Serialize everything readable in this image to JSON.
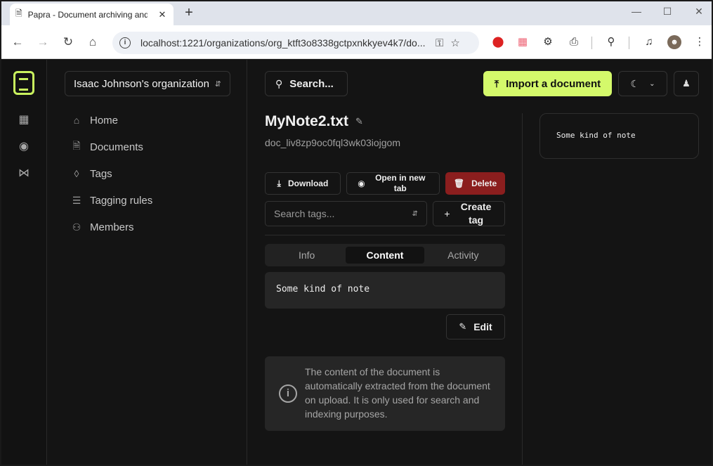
{
  "browser": {
    "tab_title": "Papra - Document archiving and",
    "url": "localhost:1221/organizations/org_ktft3o8338gctpxnkkyev4k7/do..."
  },
  "sidebar": {
    "organization": "Isaac Johnson's organization",
    "items": [
      {
        "label": "Home",
        "icon": "home-icon"
      },
      {
        "label": "Documents",
        "icon": "file-icon"
      },
      {
        "label": "Tags",
        "icon": "tag-icon"
      },
      {
        "label": "Tagging rules",
        "icon": "list-check-icon"
      },
      {
        "label": "Members",
        "icon": "users-icon"
      }
    ]
  },
  "header": {
    "search_label": "Search...",
    "import_label": "Import a document"
  },
  "document": {
    "title": "MyNote2.txt",
    "id": "doc_liv8zp9oc0fql3wk03iojgom",
    "download_label": "Download",
    "open_label": "Open in new tab",
    "delete_label": "Delete",
    "tag_search_placeholder": "Search tags...",
    "create_tag_label": "Create tag",
    "tabs": [
      "Info",
      "Content",
      "Activity"
    ],
    "active_tab": "Content",
    "content": "Some kind of note",
    "edit_label": "Edit",
    "info_text": "The content of the document is automatically extracted from the document on upload. It is only used for search and indexing purposes."
  },
  "preview": {
    "text": "Some kind of note"
  },
  "colors": {
    "accent": "#d4f96b",
    "danger": "#8b1e1e",
    "background": "#141414"
  }
}
